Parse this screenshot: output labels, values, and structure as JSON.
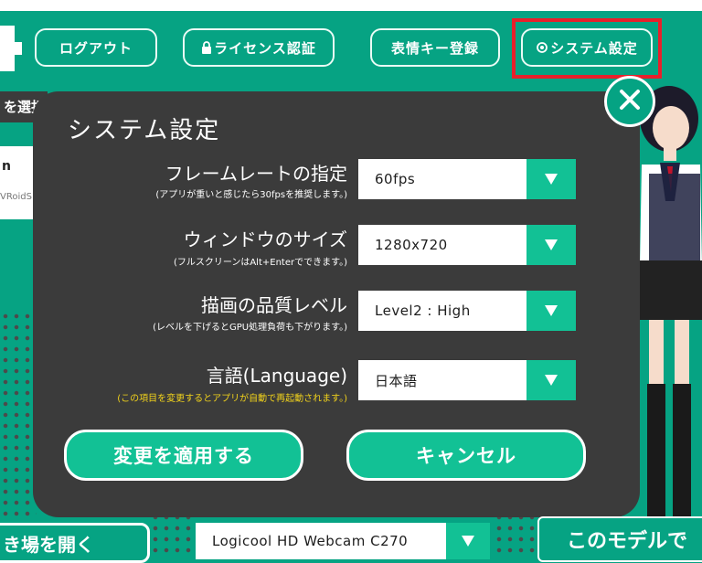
{
  "header": {
    "logout_label": "ログアウト",
    "license_label": "ライセンス認証",
    "expression_key_label": "表情キー登録",
    "system_settings_label": "システム設定"
  },
  "background": {
    "model_select_label": "を選択",
    "model_card_name": "n",
    "model_card_sub": "VRoidS",
    "open_storage_label": "き場を開く",
    "camera_value": "Logicool HD Webcam C270",
    "use_model_label": "このモデルで"
  },
  "dialog": {
    "title": "システム設定",
    "rows": [
      {
        "label": "フレームレートの指定",
        "note": "(アプリが重いと感じたら30fpsを推奨します。)",
        "value": "60fps"
      },
      {
        "label": "ウィンドウのサイズ",
        "note": "(フルスクリーンはAlt+Enterでできます。)",
        "value": "1280x720"
      },
      {
        "label": "描画の品質レベル",
        "note": "(レベルを下げるとGPU処理負荷も下がります。)",
        "value": "Level2 : High"
      },
      {
        "label": "言語(Language)",
        "note": "(この項目を変更するとアプリが自動で再起動されます。)",
        "value": "日本語"
      }
    ],
    "apply_label": "変更を適用する",
    "cancel_label": "キャンセル"
  },
  "colors": {
    "accent": "#06a383",
    "button_fill": "#12c195",
    "dialog_bg": "#3b3b3b",
    "warning_text": "#f2d31b",
    "highlight": "#e8202b"
  }
}
